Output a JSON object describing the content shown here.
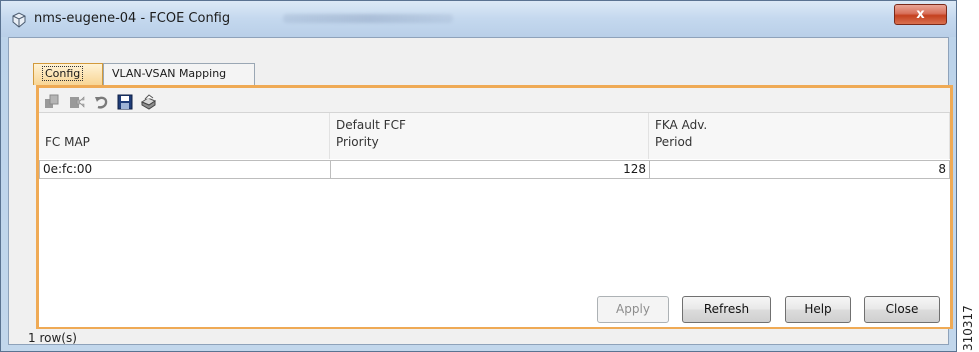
{
  "window": {
    "title": "nms-eugene-04 - FCOE Config",
    "close_label": "x"
  },
  "tabs": [
    {
      "label": "Config",
      "active": true
    },
    {
      "label": "VLAN-VSAN Mapping",
      "active": false
    }
  ],
  "toolbar": {
    "icons": [
      "copy-icon",
      "paste-icon",
      "undo-icon",
      "save-icon",
      "print-icon"
    ]
  },
  "table": {
    "columns": [
      {
        "line1": "",
        "line2": "FC MAP"
      },
      {
        "line1": "Default FCF",
        "line2": "Priority"
      },
      {
        "line1": "FKA Adv.",
        "line2": "Period"
      }
    ],
    "rows": [
      {
        "fc_map": "0e:fc:00",
        "priority": "128",
        "fka_period": "8"
      }
    ]
  },
  "buttons": {
    "apply": "Apply",
    "refresh": "Refresh",
    "help": "Help",
    "close": "Close"
  },
  "status": "1 row(s)",
  "figure_id": "310317",
  "colors": {
    "panel_border": "#efaa55",
    "active_tab": "#f8d594",
    "close_button": "#c4401f"
  }
}
